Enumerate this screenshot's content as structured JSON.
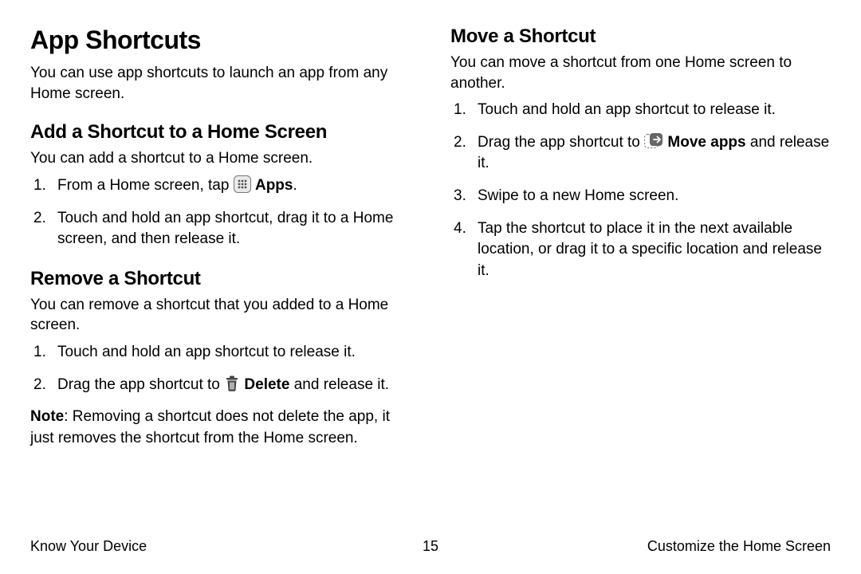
{
  "left": {
    "title": "App Shortcuts",
    "intro": "You can use app shortcuts to launch an app from any Home screen.",
    "add": {
      "heading": "Add a Shortcut to a Home Screen",
      "intro": "You can add a shortcut to a Home screen.",
      "step1_pre": "From a Home screen, tap ",
      "step1_label": "Apps",
      "step1_post": ".",
      "step2": "Touch and hold an app shortcut, drag it to a Home screen, and then release it."
    },
    "remove": {
      "heading": "Remove a Shortcut",
      "intro": "You can remove a shortcut that you added to a Home screen.",
      "step1": "Touch and hold an app shortcut to release it.",
      "step2_pre": "Drag the app shortcut to ",
      "step2_label": "Delete",
      "step2_post": " and release it.",
      "note_label": "Note",
      "note_body": ": Removing a shortcut does not delete the app, it just removes the shortcut from the Home screen."
    }
  },
  "right": {
    "move": {
      "heading": "Move a Shortcut",
      "intro": "You can move a shortcut from one Home screen to another.",
      "step1": "Touch and hold an app shortcut to release it.",
      "step2_pre": "Drag the app shortcut to ",
      "step2_label": "Move apps",
      "step2_post": " and release it.",
      "step3": "Swipe to a new Home screen.",
      "step4": "Tap the shortcut to place it in the next available location, or drag it to a specific location and release it."
    }
  },
  "footer": {
    "left": "Know Your Device",
    "center": "15",
    "right": "Customize the Home Screen"
  }
}
